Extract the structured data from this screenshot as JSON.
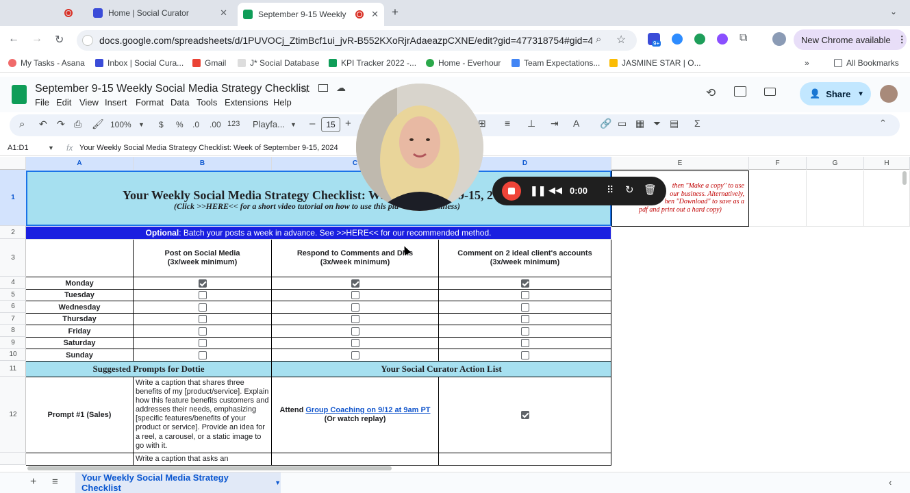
{
  "browser": {
    "tabs": [
      {
        "label": "",
        "recording": true
      },
      {
        "label": "Home | Social Curator"
      },
      {
        "label": "September 9-15 Weekly S",
        "active": true
      }
    ],
    "url": "docs.google.com/spreadsheets/d/1PUVOCj_ZtimBcf1ui_jvR-B552KXoRjrAdaeazpCXNE/edit?gid=477318754#gid=4...",
    "update_label": "New Chrome available",
    "ext_badge": "9+",
    "bookmarks": [
      "My Tasks - Asana",
      "Inbox | Social Cura...",
      "Gmail",
      "J* Social Database",
      "KPI Tracker 2022 -...",
      "Home - Everhour",
      "Team Expectations...",
      "JASMINE STAR | O..."
    ],
    "all_bookmarks": "All Bookmarks"
  },
  "doc": {
    "title": "September 9-15 Weekly Social Media Strategy Checklist",
    "menus": [
      "File",
      "Edit",
      "View",
      "Insert",
      "Format",
      "Data",
      "Tools",
      "Extensions",
      "Help"
    ],
    "share_label": "Share",
    "zoom": "100%",
    "font": "Playfa...",
    "font_size": "15",
    "currency": "$",
    "percent": "%",
    "dec_less": ".0",
    "dec_more": ".00",
    "num_format": "123",
    "name_box": "A1:D1",
    "formula": "Your Weekly Social Media Strategy Checklist: Week of September 9-15, 2024"
  },
  "grid": {
    "columns": [
      "A",
      "B",
      "C",
      "D",
      "E",
      "F",
      "G",
      "H"
    ],
    "rows": [
      "1",
      "2",
      "3",
      "4",
      "5",
      "6",
      "7",
      "8",
      "9",
      "10",
      "11",
      "12",
      ""
    ],
    "title_line": "Your Weekly Social Media Strategy Checklist: Wee",
    "title_tail": "9-15, 2",
    "subtitle": "(Click >>HERE<< for a short video tutorial on how to use this pla",
    "subtitle_tail": "usiness)",
    "optional_bold": "Optional",
    "optional_rest": ": Batch your posts a week in advance. See >>HERE<< for our recommended method.",
    "note_lines": [
      "then \"Make a copy\" to use",
      "our business. Alternatively,",
      "hen \"Download\" to save as a",
      "pdf and print out a hard copy)"
    ],
    "headers": [
      "Post on Social Media\n(3x/week minimum)",
      "Respond to Comments and DMs\n(3x/week minimum)",
      "Comment on 2 ideal client's accounts\n(3x/week minimum)"
    ],
    "days": [
      "Monday",
      "Tuesday",
      "Wednesday",
      "Thursday",
      "Friday",
      "Saturday",
      "Sunday"
    ],
    "checked_monday": true,
    "prompts_header": "Suggested Prompts for Dottie",
    "action_header": "Your Social Curator Action List",
    "prompt1_label": "Prompt #1 (Sales)",
    "prompt1_text": "Write a caption that shares three benefits of my [product/service]. Explain how this feature benefits customers and addresses their needs, emphasizing [specific features/benefits of your product or service]. Provide an idea for a reel, a carousel, or a static image to go with it.",
    "action1_prefix": "Attend ",
    "action1_link": "Group Coaching on 9/12 at 9am PT",
    "action1_sub": "(Or watch replay)",
    "prompt2_text": "Write a caption that asks an"
  },
  "sheet_tab": "Your Weekly Social Media Strategy Checklist",
  "recorder": {
    "time": "0:00"
  },
  "colors": {
    "header_blue": "#1a1fe0",
    "light_blue": "#a6e0f0",
    "link": "#1155cc",
    "note_red": "#c00000"
  }
}
